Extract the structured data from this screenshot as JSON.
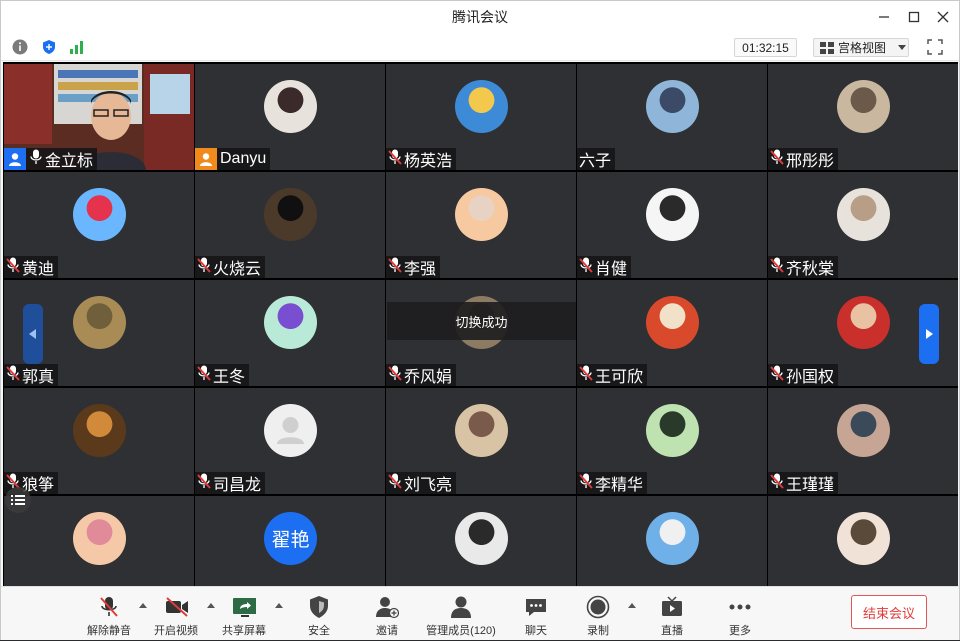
{
  "app": {
    "title": "腾讯会议"
  },
  "toolbar": {
    "timer": "01:32:15",
    "view_label": "宫格视图"
  },
  "tiles": [
    {
      "name": "金立标",
      "kind": "video",
      "tag": "host-cam"
    },
    {
      "name": "Danyu",
      "kind": "person",
      "c1": "#e8e2dc",
      "c2": "#3a2a2a"
    },
    {
      "name": "杨英浩",
      "kind": "muted",
      "c1": "#3d8ad6",
      "c2": "#f2c94c"
    },
    {
      "name": "六子",
      "kind": "nomic",
      "c1": "#8fb6d8",
      "c2": "#3b4a66"
    },
    {
      "name": "邢彤彤",
      "kind": "muted",
      "c1": "#c9b7a0",
      "c2": "#6b5a4a"
    },
    {
      "name": "黄迪",
      "kind": "muted",
      "c1": "#6bb7ff",
      "c2": "#e6334d"
    },
    {
      "name": "火烧云",
      "kind": "muted",
      "c1": "#4b3a2a",
      "c2": "#101010"
    },
    {
      "name": "李强",
      "kind": "muted",
      "c1": "#f7c9a0",
      "c2": "#e8d2c4"
    },
    {
      "name": "肖健",
      "kind": "muted",
      "c1": "#f5f5f5",
      "c2": "#2a2a2a"
    },
    {
      "name": "齐秋棠",
      "kind": "muted",
      "c1": "#e7e2dc",
      "c2": "#b89e86"
    },
    {
      "name": "郭真",
      "kind": "muted",
      "c1": "#a98c55",
      "c2": "#6f5f3a"
    },
    {
      "name": "王冬",
      "kind": "muted",
      "c1": "#b9ead7",
      "c2": "#7a4ed0"
    },
    {
      "name": "乔风娟",
      "kind": "muted",
      "c1": "#8c7a63",
      "c2": "#4a3b2b"
    },
    {
      "name": "王可欣",
      "kind": "muted",
      "c1": "#d94a2c",
      "c2": "#f0e1c8"
    },
    {
      "name": "孙国权",
      "kind": "muted",
      "c1": "#c9302c",
      "c2": "#e9c1a3"
    },
    {
      "name": "狼筝",
      "kind": "muted",
      "c1": "#5a3a1a",
      "c2": "#d08a3a"
    },
    {
      "name": "司昌龙",
      "kind": "muted",
      "c1": "#efefef",
      "c2": "#d0d0d0"
    },
    {
      "name": "刘飞亮",
      "kind": "muted",
      "c1": "#d9c3a5",
      "c2": "#7a5a4a"
    },
    {
      "name": "李精华",
      "kind": "muted",
      "c1": "#bfe3b0",
      "c2": "#2a3a2a"
    },
    {
      "name": "王瑾瑾",
      "kind": "muted",
      "c1": "#c7a595",
      "c2": "#3a4a58"
    },
    {
      "name": "",
      "kind": "partial",
      "c1": "#f5c9a8",
      "c2": "#e08a9a"
    },
    {
      "name": "",
      "kind": "partial-text",
      "avatar_text": "翟艳",
      "c1": "#1d6ff2",
      "c2": "#1d6ff2"
    },
    {
      "name": "",
      "kind": "partial",
      "c1": "#e9e9e9",
      "c2": "#2a2a2a"
    },
    {
      "name": "",
      "kind": "partial",
      "c1": "#6fb0e8",
      "c2": "#f0f0f0"
    },
    {
      "name": "",
      "kind": "partial",
      "c1": "#f1e2d8",
      "c2": "#5a4a3a"
    }
  ],
  "toast": "切换成功",
  "bottom": {
    "unmute": "解除静音",
    "video": "开启视频",
    "share": "共享屏幕",
    "security": "安全",
    "invite": "邀请",
    "members": "管理成员(120)",
    "chat": "聊天",
    "record": "录制",
    "live": "直播",
    "more": "更多",
    "end": "结束会议"
  },
  "colors": {
    "accent": "#1d6ff2",
    "danger": "#e03b3b",
    "muted_mic": "#e23b3b"
  }
}
